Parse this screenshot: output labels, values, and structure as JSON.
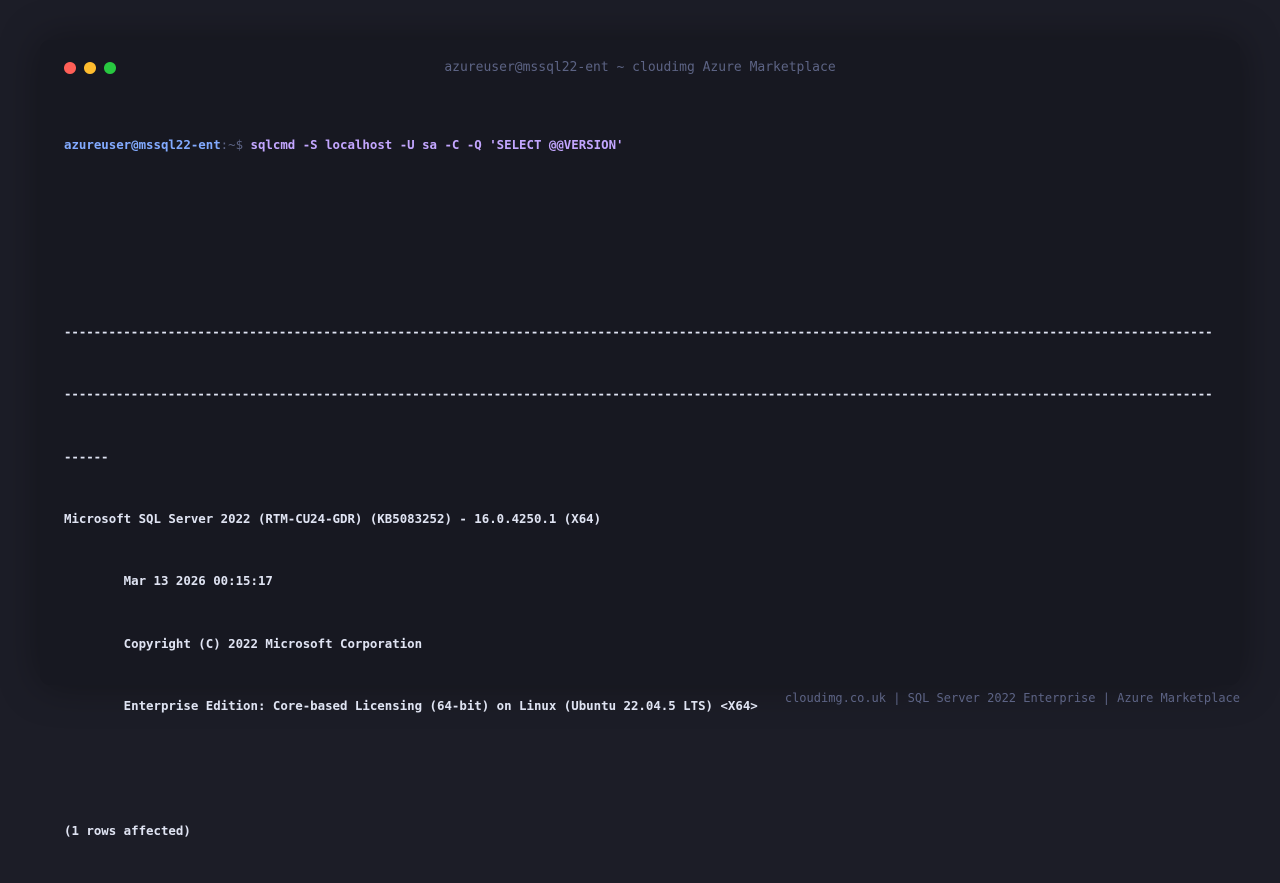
{
  "window": {
    "title": "azureuser@mssql22-ent ~ cloudimg Azure Marketplace",
    "traffic_lights": {
      "close": "#ff5f57",
      "minimize": "#febc2e",
      "maximize": "#28c840"
    }
  },
  "prompt": {
    "user_host": "azureuser@mssql22-ent",
    "path_symbol": ":~$ ",
    "command": "sqlcmd -S localhost -U sa -C -Q 'SELECT @@VERSION'"
  },
  "output": {
    "blank_1": "",
    "blank_2": "",
    "dashes_1": "-----------------------------------------------------------------------------------------------------------------------------------------------------------",
    "dashes_2": "-----------------------------------------------------------------------------------------------------------------------------------------------------------",
    "dashes_3": "------",
    "version_line": "Microsoft SQL Server 2022 (RTM-CU24-GDR) (KB5083252) - 16.0.4250.1 (X64)",
    "date_line": "        Mar 13 2026 00:15:17",
    "copyright_line": "        Copyright (C) 2022 Microsoft Corporation",
    "edition_line": "        Enterprise Edition: Core-based Licensing (64-bit) on Linux (Ubuntu 22.04.5 LTS) <X64>",
    "blank_3": "",
    "rows_affected": "(1 rows affected)"
  },
  "footer": "cloudimg.co.uk | SQL Server 2022 Enterprise | Azure Marketplace",
  "colors": {
    "background": "#1c1d27",
    "window": "#171821",
    "prompt_user": "#82aaff",
    "command": "#c3a6ff",
    "output_text": "#dfe3f2",
    "muted": "#5c6384"
  }
}
